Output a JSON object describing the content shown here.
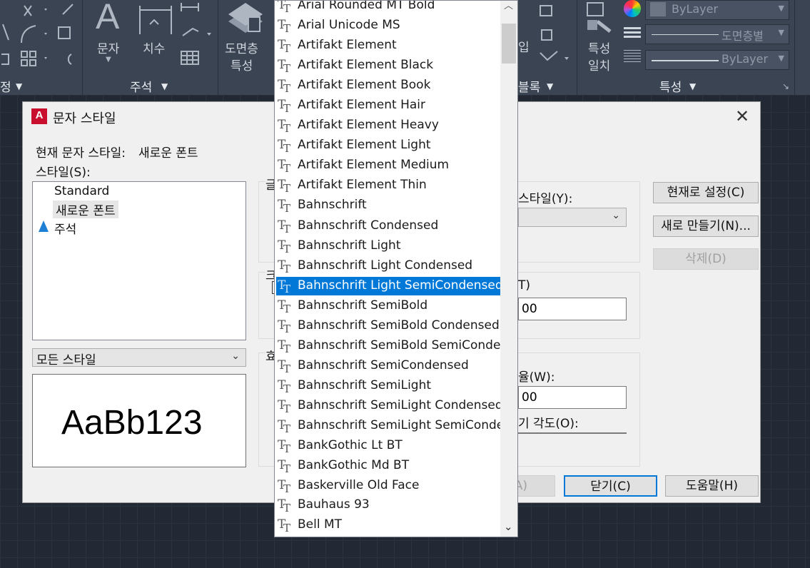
{
  "ribbon": {
    "left_title": "정",
    "tools_text_label": "문자",
    "tools_dim_label": "치수",
    "layer_tool_label_1": "도면층",
    "layer_tool_label_2": "특성",
    "annotate_panel_title": "주석",
    "block_panel_title": "블록",
    "match_label_1": "특성",
    "match_label_2": "일치",
    "properties_panel_title": "특성",
    "color_value": "ByLayer",
    "linetype_value": "도면층별",
    "lineweight_value": "ByLayer",
    "block_insert_label": "입"
  },
  "dialog": {
    "title": "문자 스타일",
    "current_style_label": "현재 문자 스타일:",
    "current_style_value": "새로운 폰트",
    "styles_label": "스타일(S):",
    "styles": [
      "Standard",
      "새로운 폰트",
      "주석"
    ],
    "filter_value": "모든 스타일",
    "preview_text": "AaBb123",
    "font_group_label": "글",
    "size_group_label": "크",
    "effects_group_label": "효",
    "font_style_label": "스타일(Y):",
    "height_label_suffix": "T)",
    "height_value_suffix": "00",
    "width_factor_label": "율(W):",
    "width_factor_value_suffix": "00",
    "oblique_label": "기 각도(O):",
    "btn_set_current": "현재로 설정(C)",
    "btn_new": "새로 만들기(N)...",
    "btn_delete": "삭제(D)",
    "btn_apply_suffix": "A)",
    "btn_close": "닫기(C)",
    "btn_help": "도움말(H)"
  },
  "fontlist": {
    "items": [
      "Arial Rounded MT Bold",
      "Arial Unicode MS",
      "Artifakt Element",
      "Artifakt Element Black",
      "Artifakt Element Book",
      "Artifakt Element Hair",
      "Artifakt Element Heavy",
      "Artifakt Element Light",
      "Artifakt Element Medium",
      "Artifakt Element Thin",
      "Bahnschrift",
      "Bahnschrift Condensed",
      "Bahnschrift Light",
      "Bahnschrift Light Condensed",
      "Bahnschrift Light SemiCondensed",
      "Bahnschrift SemiBold",
      "Bahnschrift SemiBold Condensed",
      "Bahnschrift SemiBold SemiConden",
      "Bahnschrift SemiCondensed",
      "Bahnschrift SemiLight",
      "Bahnschrift SemiLight Condensed",
      "Bahnschrift SemiLight SemiConde",
      "BankGothic Lt BT",
      "BankGothic Md BT",
      "Baskerville Old Face",
      "Bauhaus 93",
      "Bell MT"
    ],
    "selected": "Bahnschrift Light SemiCondensed",
    "icon_glyph": "T"
  },
  "colors": {
    "ribbon_bg": "#3b4453",
    "canvas_bg": "#222834",
    "selection": "#0078d7",
    "autocad_red": "#c8102e"
  }
}
